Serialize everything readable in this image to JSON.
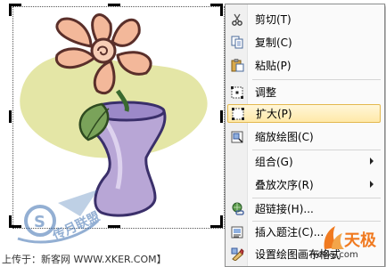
{
  "menu": {
    "items": [
      {
        "label": "剪切(T)",
        "icon": "scissors-icon"
      },
      {
        "label": "复制(C)",
        "icon": "copy-icon"
      },
      {
        "label": "粘贴(P)",
        "icon": "paste-icon"
      },
      {
        "label": "调整",
        "icon": "adjust-icon"
      },
      {
        "label": "扩大(P)",
        "icon": "expand-icon",
        "highlighted": true
      },
      {
        "label": "缩放绘图(C)",
        "icon": "scale-drawing-icon"
      },
      {
        "label": "组合(G)",
        "icon": "group-icon",
        "submenu": true
      },
      {
        "label": "叠放次序(R)",
        "icon": "order-icon",
        "submenu": true
      },
      {
        "label": "超链接(H)...",
        "icon": "hyperlink-icon"
      },
      {
        "label": "插入题注(C)...",
        "icon": "caption-icon"
      },
      {
        "label": "设置绘图画布格式",
        "icon": "format-canvas-icon"
      }
    ]
  },
  "watermark": {
    "text": "传月联盟"
  },
  "credit": {
    "text": "上传于：新客网 WWW.XKER.COM】"
  },
  "brand": {
    "name": "天极",
    "url": "yesky.com"
  },
  "colors": {
    "highlight_border": "#e3b84e",
    "highlight_fill": "#ffe9a8",
    "petal": "#f3b89a",
    "vase": "#b8a6d6",
    "leaf": "#7aa35a",
    "splash": "#e4e6a6"
  }
}
